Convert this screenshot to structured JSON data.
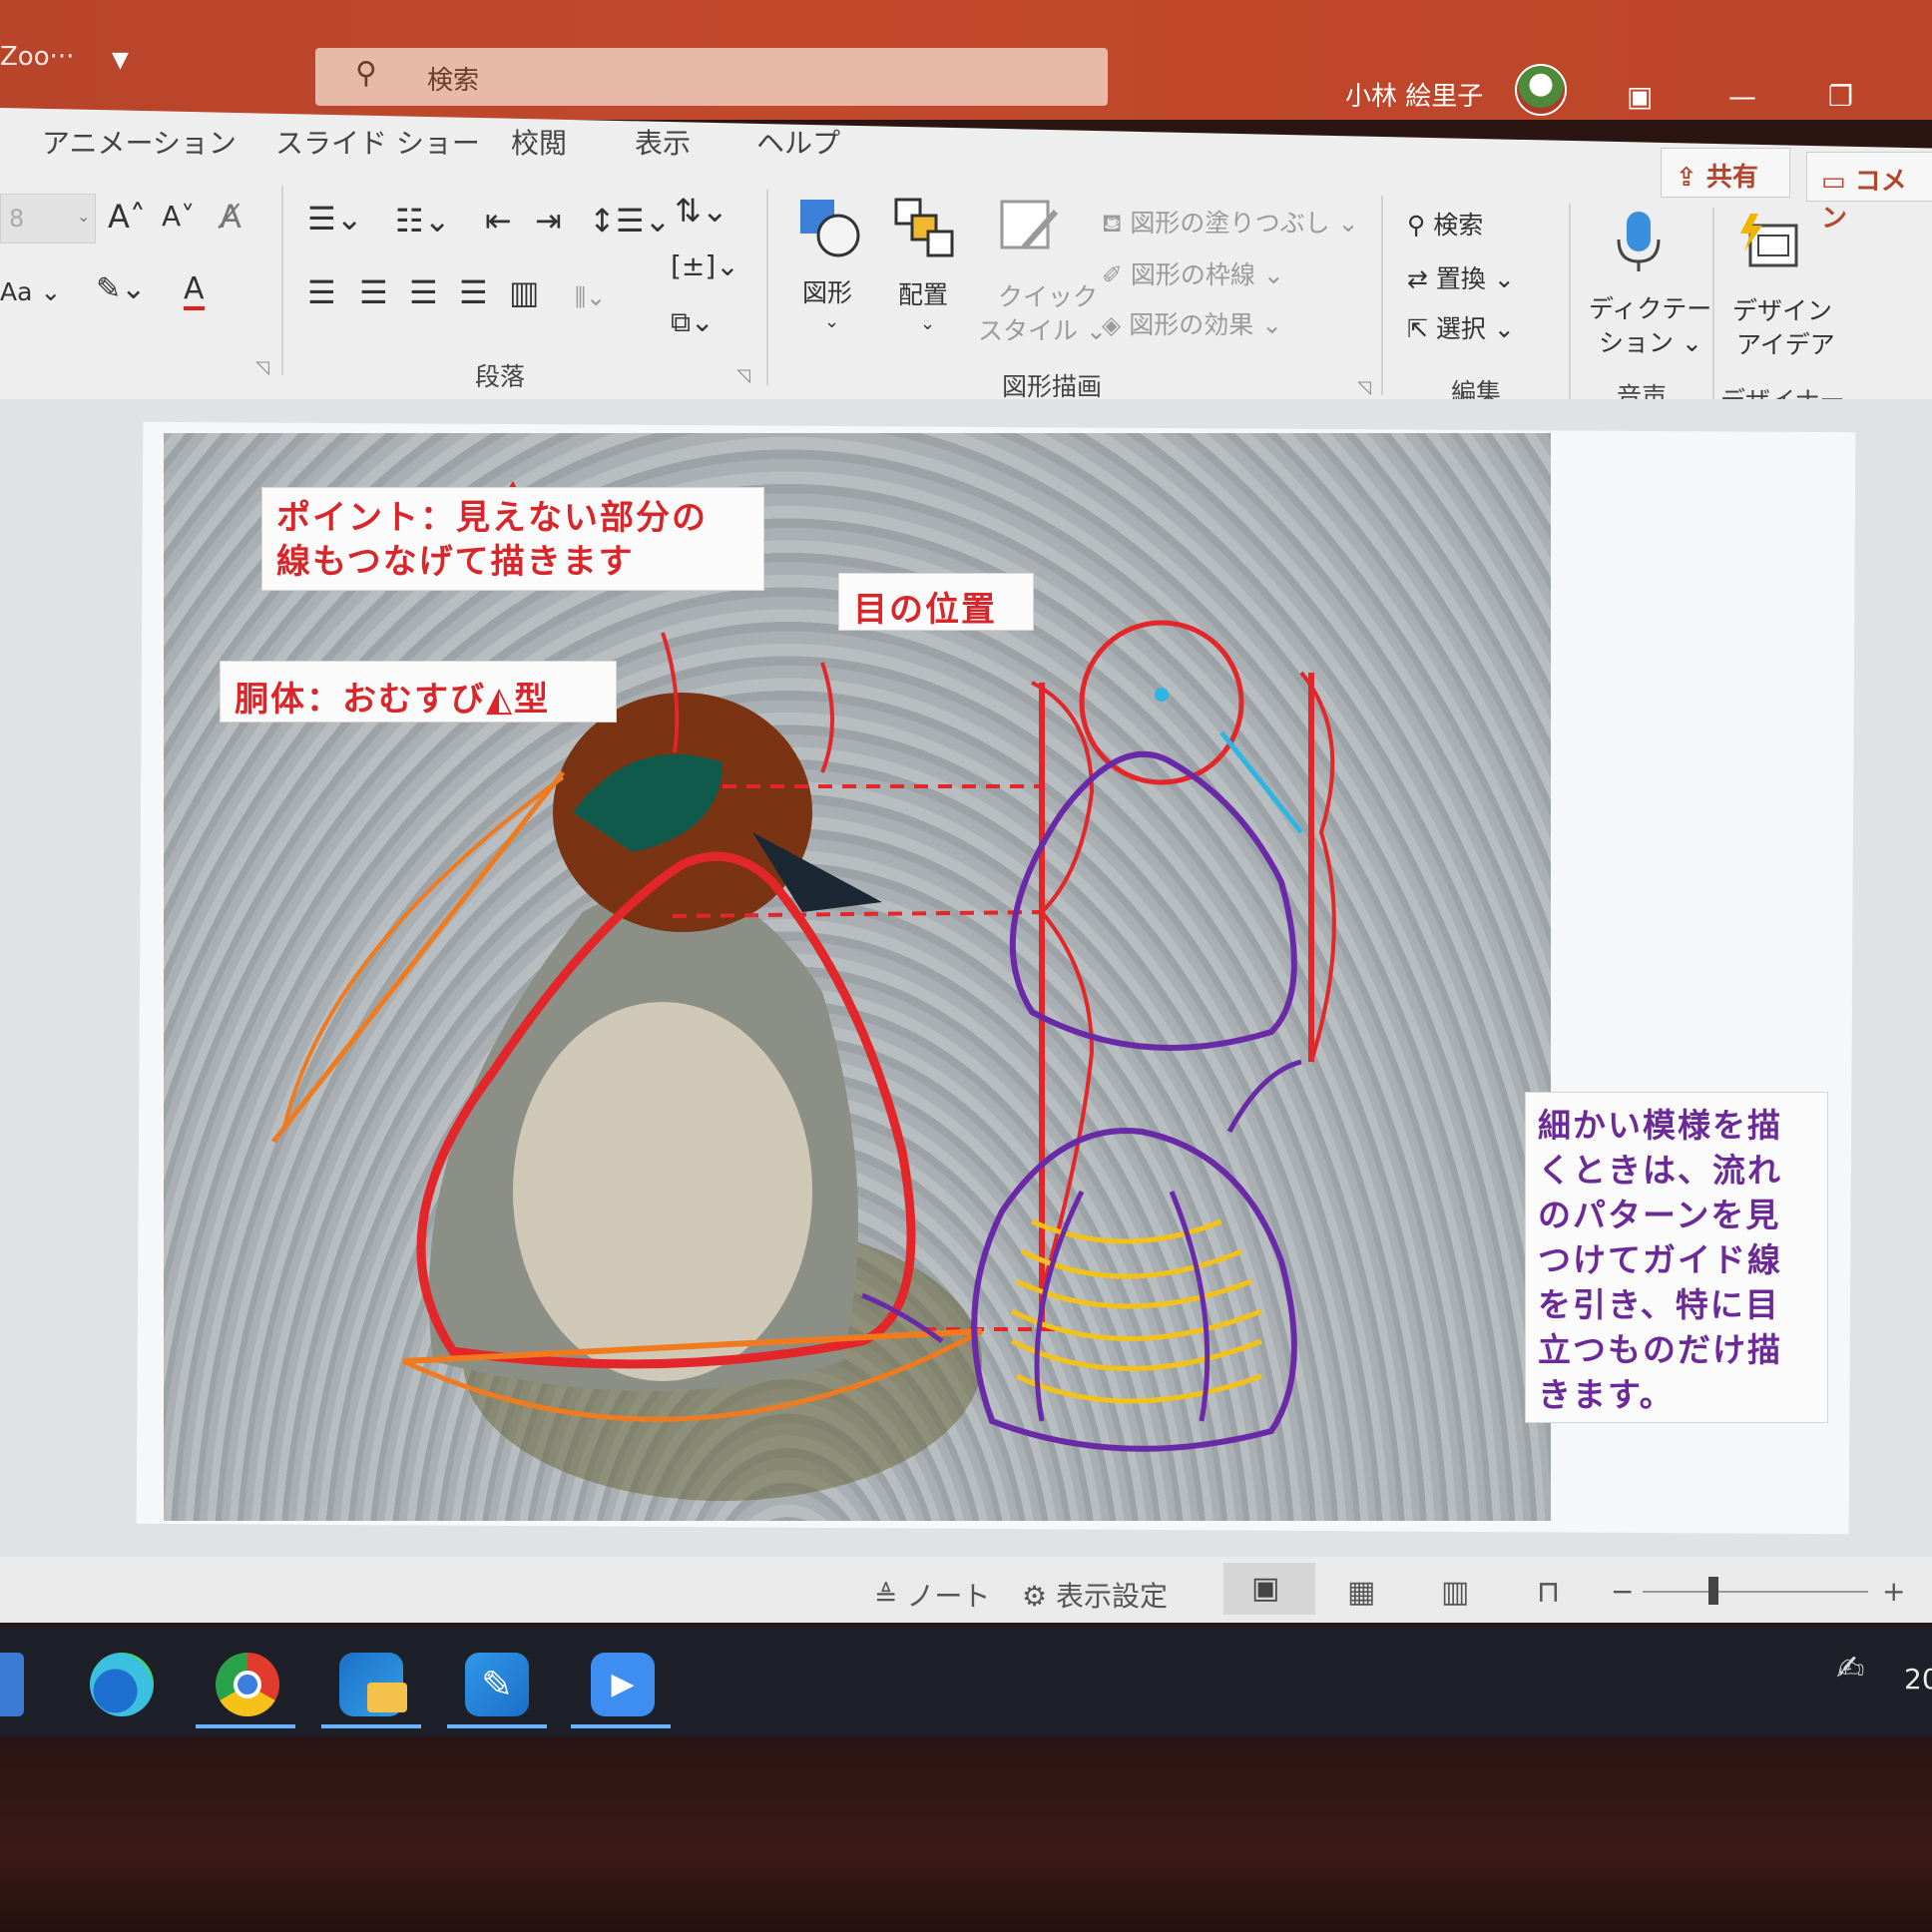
{
  "window": {
    "doc_name": "Zoo···",
    "search_placeholder": "検索",
    "user_name": "小林 絵里子",
    "share_label": "共有",
    "comment_label": "コメン"
  },
  "tabs": [
    "アニメーション",
    "スライド ショー",
    "校閲",
    "表示",
    "ヘルプ"
  ],
  "ribbon": {
    "font_size_value": "8",
    "case_label": "Aa",
    "paragraph_group": "段落",
    "shape_label": "図形",
    "arrange_label": "配置",
    "quick_style_line1": "クイック",
    "quick_style_line2": "スタイル",
    "fill_label": "図形の塗りつぶし",
    "outline_label": "図形の枠線",
    "effect_label": "図形の効果",
    "drawing_group": "図形描画",
    "find_label": "検索",
    "replace_label": "置換",
    "select_label": "選択",
    "editing_group": "編集",
    "dictate_line1": "ディクテー",
    "dictate_line2": "ション",
    "voice_group": "音声",
    "design_line1": "デザイン",
    "design_line2": "アイデア",
    "designer_group": "デザイナー"
  },
  "slide": {
    "point_line1": "ポイント：見えない部分の",
    "point_line2": "線もつなげて描きます",
    "eye_label": "目の位置",
    "body_label": "胴体：おむすび",
    "body_suffix": "型",
    "pattern_lines": [
      "細かい模様を描",
      "くときは、流れ",
      "のパターンを見",
      "つけてガイド線",
      "を引き、特に目",
      "立つものだけ描",
      "きます。"
    ]
  },
  "status": {
    "notes_label": "ノート",
    "display_settings_label": "表示設定",
    "zoom_minus": "−",
    "zoom_plus": "+",
    "clock_partial": "20"
  },
  "colors": {
    "titlebar": "#c2492c",
    "annotation_red": "#e3262a",
    "annotation_orange": "#f07a1e",
    "annotation_purple": "#6a2aa8",
    "annotation_yellow": "#f3c21a",
    "annotation_cyan": "#2bb6e6"
  }
}
